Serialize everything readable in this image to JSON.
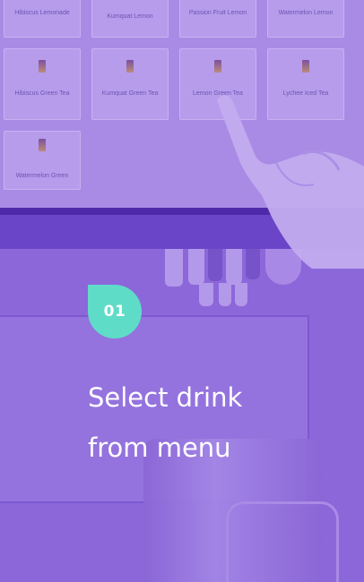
{
  "menu": {
    "top_row": [
      "Hibiscus Lemonade",
      "Kumquat Lemon",
      "Passion Fruit Lemon",
      "Watermelon Lemon"
    ],
    "middle_row": [
      "Hibiscus Green Tea",
      "Kumquat Green Tea",
      "Lemon Green Tea",
      "Lychee Iced Tea"
    ],
    "bottom_row": [
      "Watermelon Green"
    ]
  },
  "step": {
    "number": "01",
    "title_line_1": "Select drink",
    "title_line_2": "from menu"
  },
  "colors": {
    "overlay": "#8a64d8",
    "badge": "#5fdcc8",
    "title_text": "#ffffff"
  },
  "icons": {
    "badge_shape": "teardrop",
    "hand": "pointing-hand"
  }
}
